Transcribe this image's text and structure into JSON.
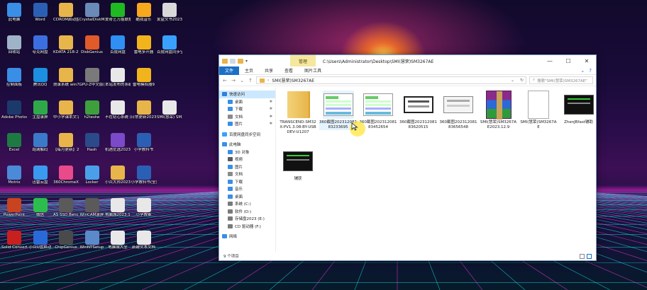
{
  "desktop_icons": [
    {
      "label": "此电脑",
      "icon": "computer-icon",
      "color": "#3a8ee6",
      "col": 0,
      "row": 0
    },
    {
      "label": "Word",
      "icon": "word-icon",
      "color": "#2b5fb4",
      "col": 1,
      "row": 0
    },
    {
      "label": "CDROM启动盘制作工具",
      "icon": "folder-icon",
      "color": "#e8b54a",
      "col": 2,
      "row": 0
    },
    {
      "label": "CrystalDiskMark中文版(便携版)",
      "icon": "disk-icon",
      "color": "#6a8ab8",
      "col": 3,
      "row": 0
    },
    {
      "label": "爱奇艺万能联播",
      "icon": "iqiyi-icon",
      "color": "#1fb922",
      "col": 4,
      "row": 0
    },
    {
      "label": "酷我音乐",
      "icon": "kuwo-icon",
      "color": "#f7a81c",
      "col": 5,
      "row": 0
    },
    {
      "label": "友益文书2023",
      "icon": "book-icon",
      "color": "#d9d9d9",
      "col": 6,
      "row": 0
    },
    {
      "label": "回收站",
      "icon": "recycle-bin-icon",
      "color": "#9fb3c8",
      "col": 0,
      "row": 1
    },
    {
      "label": "夸克网盘",
      "icon": "quark-icon",
      "color": "#3b6fe0",
      "col": 1,
      "row": 1
    },
    {
      "label": "KDATA 218-2量产...",
      "icon": "folder-icon",
      "color": "#e8b54a",
      "col": 2,
      "row": 1
    },
    {
      "label": "DiskGenius",
      "icon": "diskgenius-icon",
      "color": "#e05a2a",
      "col": 3,
      "row": 1
    },
    {
      "label": "百度网盘",
      "icon": "baidu-netdisk-icon",
      "color": "#2f8ff2",
      "col": 4,
      "row": 1
    },
    {
      "label": "雷电多开器",
      "icon": "leidian-icon",
      "color": "#f2b41c",
      "col": 5,
      "row": 1
    },
    {
      "label": "百度网盘同步空间",
      "icon": "baidu-sync-icon",
      "color": "#3aa0ff",
      "col": 6,
      "row": 1
    },
    {
      "label": "控制面板",
      "icon": "control-panel-icon",
      "color": "#3a8ee6",
      "col": 0,
      "row": 2
    },
    {
      "label": "腾讯QQ",
      "icon": "qq-icon",
      "color": "#1c8fe0",
      "col": 1,
      "row": 2
    },
    {
      "label": "烧录系统 win7win10...",
      "icon": "folder-icon",
      "color": "#e8b54a",
      "col": 2,
      "row": 2
    },
    {
      "label": "GPU-Z中文版(显卡检测)",
      "icon": "gpuz-icon",
      "color": "#7a7a7a",
      "col": 3,
      "row": 2
    },
    {
      "label": "本站发布的系统仅为个人...",
      "icon": "document-icon",
      "color": "#e8e8e8",
      "col": 4,
      "row": 2
    },
    {
      "label": "雷电模拟器9",
      "icon": "leidian-icon",
      "color": "#f2b41c",
      "col": 5,
      "row": 2
    },
    {
      "label": "Adobe Photosh...",
      "icon": "photoshop-icon",
      "color": "#1b3a6b",
      "col": 0,
      "row": 3
    },
    {
      "label": "主盘录屏",
      "icon": "recorder-icon",
      "color": "#2fa84a",
      "col": 1,
      "row": 3
    },
    {
      "label": "中小学课本文字(资源库...)",
      "icon": "folder-icon",
      "color": "#e8b54a",
      "col": 2,
      "row": 3
    },
    {
      "label": "h2testw",
      "icon": "h2testw-icon",
      "color": "#3da03d",
      "col": 3,
      "row": 3
    },
    {
      "label": "不在初心系统下载地址...",
      "icon": "document-icon",
      "color": "#e8e8e8",
      "col": 4,
      "row": 3
    },
    {
      "label": "日常更新2023.12",
      "icon": "folder-icon",
      "color": "#e8b54a",
      "col": 5,
      "row": 3
    },
    {
      "label": "SMI(慧荣) SM3267AE",
      "icon": "document-icon",
      "color": "#e8e8e8",
      "col": 6,
      "row": 3
    },
    {
      "label": "Excel",
      "icon": "excel-icon",
      "color": "#1e7a43",
      "col": 0,
      "row": 4
    },
    {
      "label": "跑满解码",
      "icon": "decode-icon",
      "color": "#3a7ac8",
      "col": 1,
      "row": 4
    },
    {
      "label": "【每月更新】2023年双...",
      "icon": "folder-icon",
      "color": "#e8b54a",
      "col": 2,
      "row": 4
    },
    {
      "label": "Hash",
      "icon": "hash-icon",
      "color": "#2a4a8a",
      "col": 3,
      "row": 4
    },
    {
      "label": "机遇优选2023.10",
      "icon": "image-icon",
      "color": "#7a4ac8",
      "col": 4,
      "row": 4
    },
    {
      "label": "小学教科书",
      "icon": "word-icon",
      "color": "#2b5fb4",
      "col": 5,
      "row": 4
    },
    {
      "label": "Motrix",
      "icon": "motrix-icon",
      "color": "#4a8ad8",
      "col": 0,
      "row": 5
    },
    {
      "label": "迅雷云盘",
      "icon": "xunlei-icon",
      "color": "#3a9af0",
      "col": 1,
      "row": 5
    },
    {
      "label": "360ChromeX",
      "icon": "chrome360-icon",
      "color": "#e84a8a",
      "col": 2,
      "row": 5
    },
    {
      "label": "Locker",
      "icon": "locker-icon",
      "color": "#4aa0e8",
      "col": 3,
      "row": 5
    },
    {
      "label": "小兵大师2023...",
      "icon": "folder-icon",
      "color": "#e8b54a",
      "col": 4,
      "row": 5
    },
    {
      "label": "小学教科书(全)",
      "icon": "word-icon",
      "color": "#2b5fb4",
      "col": 5,
      "row": 5
    },
    {
      "label": "PowerPoint",
      "icon": "powerpoint-icon",
      "color": "#c8431f",
      "col": 0,
      "row": 6
    },
    {
      "label": "微信",
      "icon": "wechat-icon",
      "color": "#2dbd4e",
      "col": 1,
      "row": 6
    },
    {
      "label": "AS SSD Benchmark",
      "icon": "assd-icon",
      "color": "#5a5a5a",
      "col": 2,
      "row": 6
    },
    {
      "label": "WinCAM录屏",
      "icon": "camera-icon",
      "color": "#5a5a5a",
      "col": 3,
      "row": 6
    },
    {
      "label": "电脑城2023.12",
      "icon": "document-icon",
      "color": "#e8e8e8",
      "col": 4,
      "row": 6
    },
    {
      "label": "小学教案",
      "icon": "document-icon",
      "color": "#e8e8e8",
      "col": 5,
      "row": 6
    },
    {
      "label": "Solid Convert...",
      "icon": "pdf-icon",
      "color": "#c8201f",
      "col": 0,
      "row": 7
    },
    {
      "label": "小兵U盘启动",
      "icon": "usb-icon",
      "color": "#2a6ad8",
      "col": 1,
      "row": 7
    },
    {
      "label": "ChipGenius",
      "icon": "chip-icon",
      "color": "#4a4a4a",
      "col": 2,
      "row": 7
    },
    {
      "label": "WinNTSetup",
      "icon": "setup-icon",
      "color": "#5a8ac8",
      "col": 3,
      "row": 7
    },
    {
      "label": "电脑城大全",
      "icon": "document-icon",
      "color": "#e8e8e8",
      "col": 4,
      "row": 7
    },
    {
      "label": "新建文本文档",
      "icon": "document-icon",
      "color": "#e8e8e8",
      "col": 5,
      "row": 7
    }
  ],
  "explorer": {
    "ribbon_context_tab": "管理",
    "title_path": "C:\\Users\\Administrator\\Desktop\\SMI(慧荣)SM3267AE",
    "ribbon_tabs": [
      {
        "label": "文件",
        "active": true
      },
      {
        "label": "主页",
        "active": false
      },
      {
        "label": "共享",
        "active": false
      },
      {
        "label": "查看",
        "active": false
      },
      {
        "label": "图片工具",
        "active": false
      }
    ],
    "address": "SMI(慧荣)SM3267AE",
    "search_placeholder": "搜索\"SMI(慧荣)SM3267AE\"",
    "nav_items": [
      {
        "label": "快速访问",
        "icon": "star-icon",
        "color": "#2f7fe0",
        "pinned": false,
        "selected": true
      },
      {
        "label": "桌面",
        "icon": "desktop-icon",
        "color": "#3a8ee6",
        "pinned": true,
        "selected": false
      },
      {
        "label": "下载",
        "icon": "download-icon",
        "color": "#3a8ee6",
        "pinned": true,
        "selected": false
      },
      {
        "label": "文档",
        "icon": "document-icon",
        "color": "#8a8a8a",
        "pinned": true,
        "selected": false
      },
      {
        "label": "图片",
        "icon": "picture-icon",
        "color": "#3a8ee6",
        "pinned": true,
        "selected": false
      },
      {
        "label": "",
        "icon": "",
        "color": "",
        "pinned": false,
        "selected": false
      },
      {
        "label": "百度网盘同步空间",
        "icon": "cloud-icon",
        "color": "#3aa0ff",
        "pinned": false,
        "selected": false
      },
      {
        "label": "",
        "icon": "",
        "color": "",
        "pinned": false,
        "selected": false
      },
      {
        "label": "此电脑",
        "icon": "computer-icon",
        "color": "#3a8ee6",
        "pinned": false,
        "selected": false
      },
      {
        "label": "3D 对象",
        "icon": "cube-icon",
        "color": "#3a8ee6",
        "pinned": false,
        "selected": false
      },
      {
        "label": "视频",
        "icon": "video-icon",
        "color": "#5a5a5a",
        "pinned": false,
        "selected": false
      },
      {
        "label": "图片",
        "icon": "picture-icon",
        "color": "#3a8ee6",
        "pinned": false,
        "selected": false
      },
      {
        "label": "文档",
        "icon": "document-icon",
        "color": "#8a8a8a",
        "pinned": false,
        "selected": false
      },
      {
        "label": "下载",
        "icon": "download-icon",
        "color": "#3a8ee6",
        "pinned": false,
        "selected": false
      },
      {
        "label": "音乐",
        "icon": "music-icon",
        "color": "#3a8ee6",
        "pinned": false,
        "selected": false
      },
      {
        "label": "桌面",
        "icon": "desktop-icon",
        "color": "#3a8ee6",
        "pinned": false,
        "selected": false
      },
      {
        "label": "系统 (C:)",
        "icon": "drive-icon",
        "color": "#7a7a7a",
        "pinned": false,
        "selected": false
      },
      {
        "label": "软件 (D:)",
        "icon": "drive-icon",
        "color": "#7a7a7a",
        "pinned": false,
        "selected": false
      },
      {
        "label": "存储盘2023 (E:)",
        "icon": "drive-icon",
        "color": "#7a7a7a",
        "pinned": false,
        "selected": false
      },
      {
        "label": "CD 驱动器 (F:)",
        "icon": "cd-drive-icon",
        "color": "#7a7a7a",
        "pinned": false,
        "selected": false
      },
      {
        "label": "",
        "icon": "",
        "color": "",
        "pinned": false,
        "selected": false
      },
      {
        "label": "网络",
        "icon": "network-icon",
        "color": "#3a8ee6",
        "pinned": false,
        "selected": false
      }
    ],
    "files": [
      {
        "name": "TRANSCEND-SM32X-PV1.3.08-BY-USBDEV-U1207",
        "kind": "folder",
        "selected": false
      },
      {
        "name": "360截图20231208183233695",
        "kind": "screenshot-green",
        "selected": true
      },
      {
        "name": "360截图20231208183452654",
        "kind": "screenshot-green",
        "selected": false
      },
      {
        "name": "360截图20231208183620515",
        "kind": "screenshot-dark",
        "selected": false
      },
      {
        "name": "360截图20231208183656548",
        "kind": "screenshot-light",
        "selected": false
      },
      {
        "name": "SMI(慧荣)SM3267AE2023.12.9",
        "kind": "rar",
        "selected": false
      },
      {
        "name": "SMI(慧荣)SM3267AE",
        "kind": "document",
        "selected": false
      },
      {
        "name": "ZhenJBfast辅助",
        "kind": "screenshot-console",
        "selected": false
      },
      {
        "name": "辅获",
        "kind": "screenshot-console",
        "selected": false
      }
    ],
    "status": "9 个项目"
  }
}
